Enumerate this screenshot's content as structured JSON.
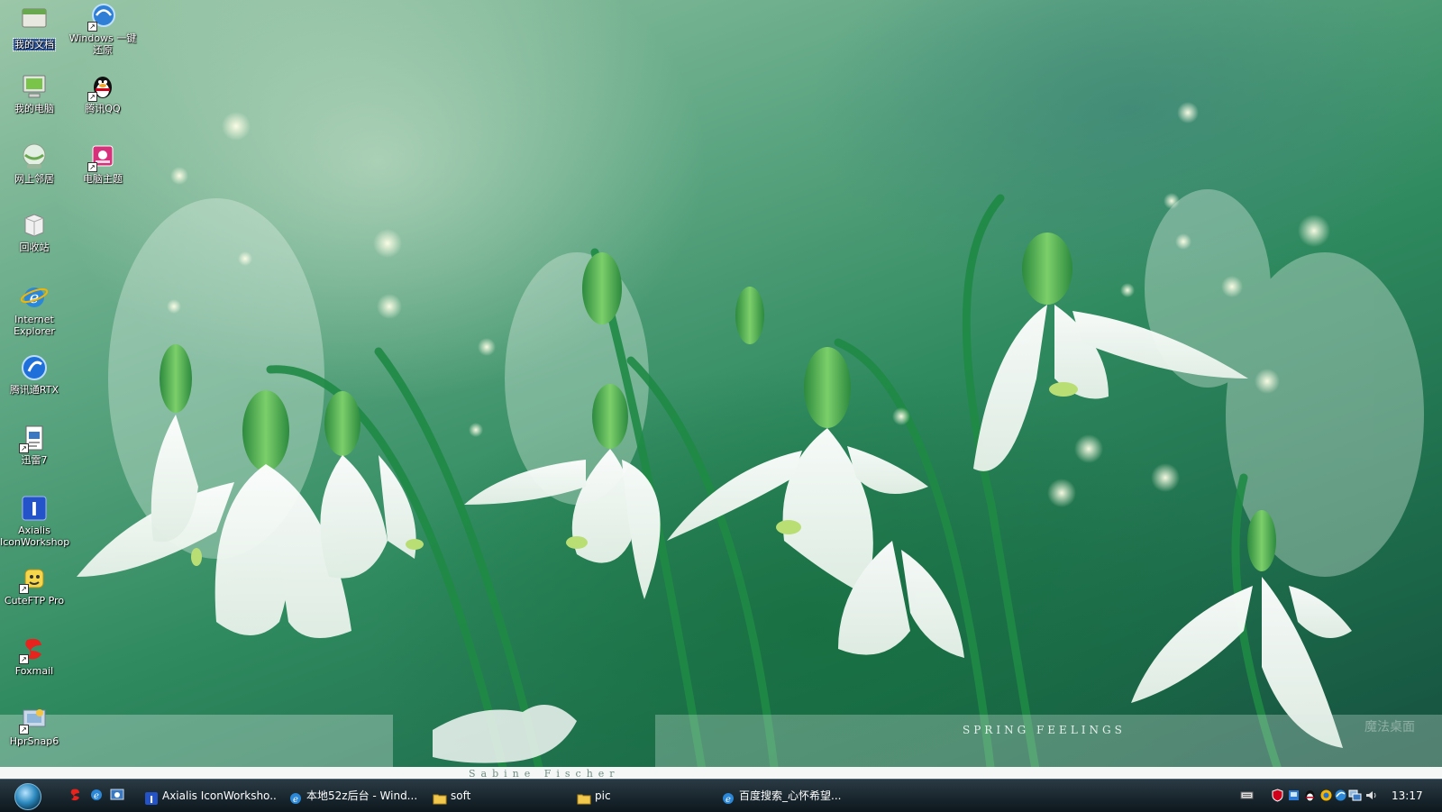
{
  "desktop": {
    "icons": [
      {
        "label": "我的文档",
        "selected": true,
        "icon": "folder-documents-icon"
      },
      {
        "label": "Windows 一键\n还原",
        "icon": "windows-restore-icon",
        "shortcut": true
      },
      {
        "label": "我的电脑",
        "icon": "computer-icon"
      },
      {
        "label": "腾讯QQ",
        "icon": "qq-penguin-icon",
        "shortcut": true
      },
      {
        "label": "网上邻居",
        "icon": "network-globe-icon"
      },
      {
        "label": "电脑主题",
        "icon": "theme-icon",
        "shortcut": true
      },
      {
        "label": "回收站",
        "icon": "recycle-bin-icon"
      },
      {
        "label": "Internet\nExplorer",
        "icon": "internet-explorer-icon"
      },
      {
        "label": "腾讯通RTX",
        "icon": "rtx-icon"
      },
      {
        "label": "迅雷7",
        "icon": "thunder-icon",
        "shortcut": true
      },
      {
        "label": "Axialis\nIconWorkshop",
        "icon": "axialis-icon"
      },
      {
        "label": "CuteFTP Pro",
        "icon": "cuteftp-icon",
        "shortcut": true
      },
      {
        "label": "Foxmail",
        "icon": "foxmail-icon",
        "shortcut": true
      },
      {
        "label": "HprSnap6",
        "icon": "hprsnap-icon",
        "shortcut": true
      }
    ]
  },
  "wallpaper": {
    "caption": "SPRING FEELINGS",
    "signature": "Sabine Fischer",
    "watermark": "魔法桌面"
  },
  "taskbar": {
    "tasks": [
      {
        "label": "Axialis IconWorksho...",
        "icon": "axialis-icon"
      },
      {
        "label": "本地52z后台 - Wind...",
        "icon": "internet-explorer-icon"
      },
      {
        "label": "soft",
        "icon": "folder-icon"
      },
      {
        "label": "pic",
        "icon": "folder-icon"
      },
      {
        "label": "百度搜索_心怀希望...",
        "icon": "internet-explorer-icon"
      }
    ],
    "clock": "13:17"
  },
  "colors": {
    "taskbar": "#14222b",
    "selection": "#315da8"
  }
}
